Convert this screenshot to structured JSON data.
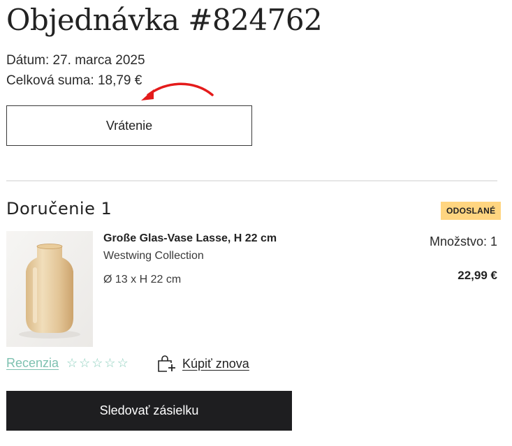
{
  "order": {
    "title": "Objednávka #824762",
    "date_text": "Dátum: 27. marca 2025",
    "total_text": "Celková suma: 18,79 €",
    "return_label": "Vrátenie"
  },
  "delivery": {
    "title": "Doručenie 1",
    "status_badge": "ODOSLANÉ",
    "status_color": "#ffd580",
    "item": {
      "name": "Große Glas-Vase Lasse, H 22 cm",
      "brand": "Westwing Collection",
      "dimensions": "Ø 13 x H 22 cm",
      "quantity_text": "Množstvo: 1",
      "price": "22,99 €",
      "image_icon": "vase-product-image"
    },
    "review_label": "Recenzia",
    "rating_stars": 5,
    "rating_value": 0,
    "buy_again_label": "Kúpiť znova",
    "track_label": "Sledovať zásielku"
  },
  "colors": {
    "accent": "#7ec1b0",
    "dark_button": "#1e1e20",
    "annotation_arrow": "#e41b1b"
  }
}
